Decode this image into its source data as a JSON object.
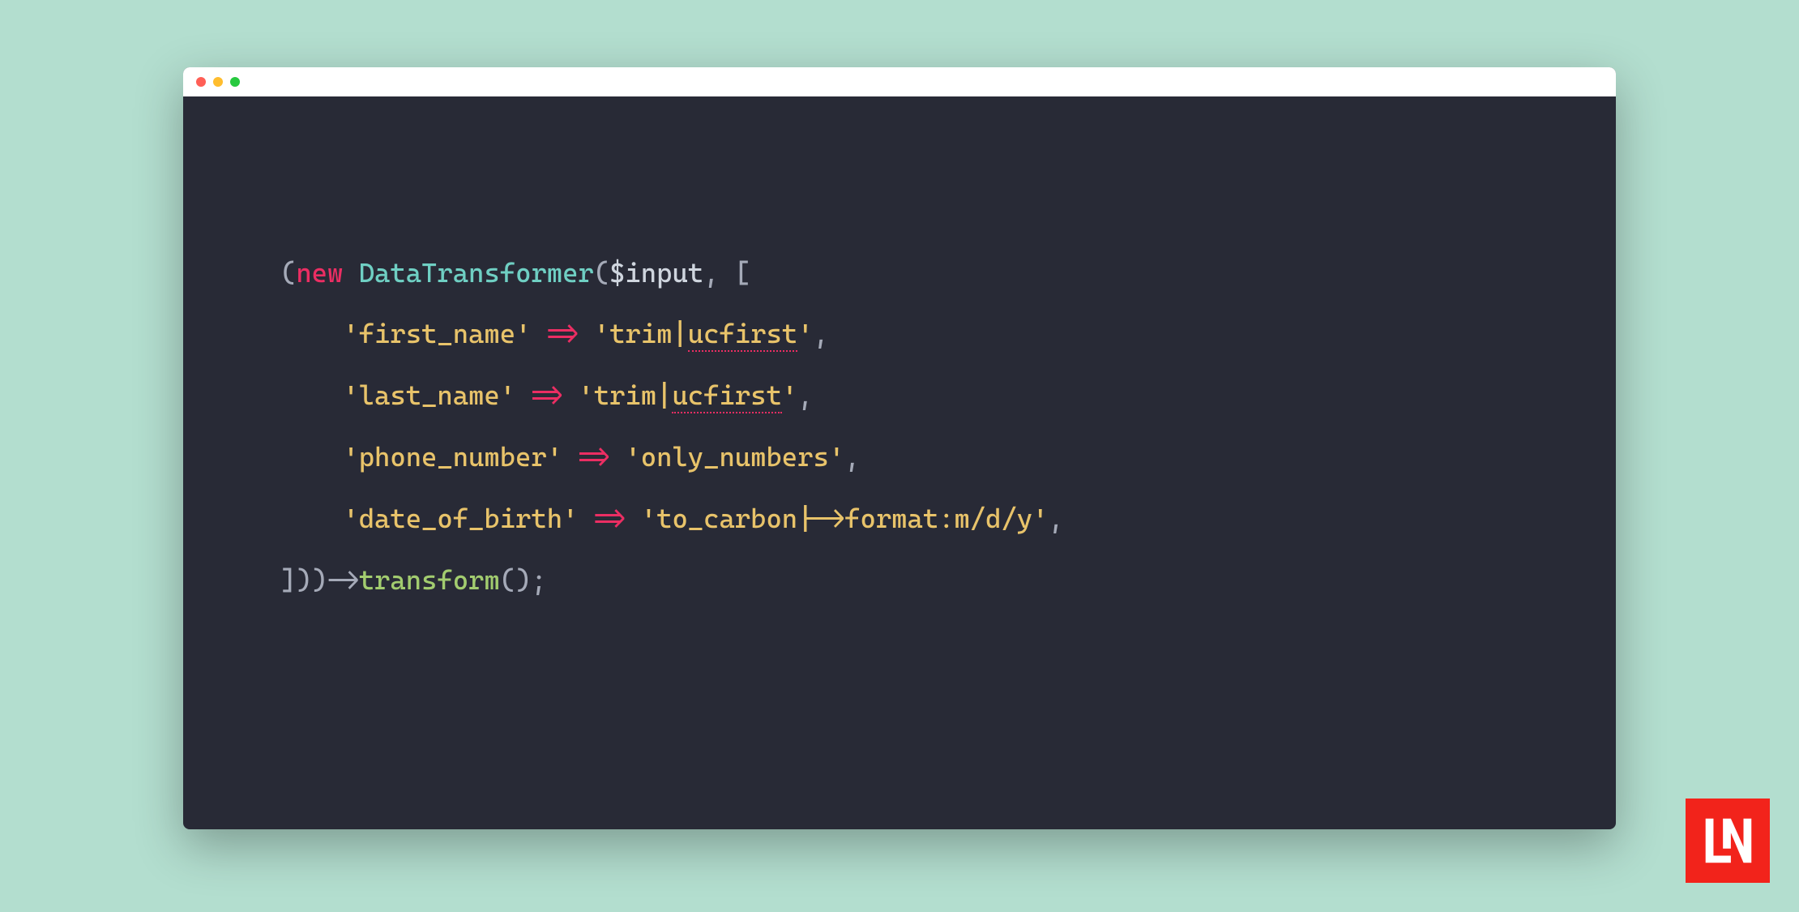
{
  "code": {
    "line1": {
      "paren_open": "(",
      "new_kw": "new",
      "space1": " ",
      "class_name": "DataTransformer",
      "paren2": "(",
      "variable": "$input",
      "comma": ", ",
      "bracket": "["
    },
    "entries": [
      {
        "indent": "    ",
        "q1": "'",
        "key": "first_name",
        "q2": "'",
        "arrow_space": " ",
        "arrow": "=>",
        "arrow_space2": " ",
        "q3": "'",
        "val_pre": "trim|",
        "val_err": "ucfirst",
        "val_post": "",
        "q4": "'",
        "comma": ","
      },
      {
        "indent": "    ",
        "q1": "'",
        "key": "last_name",
        "q2": "'",
        "arrow_space": " ",
        "arrow": "=>",
        "arrow_space2": " ",
        "q3": "'",
        "val_pre": "trim|",
        "val_err": "ucfirst",
        "val_post": "",
        "q4": "'",
        "comma": ","
      },
      {
        "indent": "    ",
        "q1": "'",
        "key": "phone_number",
        "q2": "'",
        "arrow_space": " ",
        "arrow": "=>",
        "arrow_space2": " ",
        "q3": "'",
        "val_pre": "only_numbers",
        "val_err": "",
        "val_post": "",
        "q4": "'",
        "comma": ","
      },
      {
        "indent": "    ",
        "q1": "'",
        "key": "date_of_birth",
        "q2": "'",
        "arrow_space": " ",
        "arrow": "=>",
        "arrow_space2": " ",
        "q3": "'",
        "val_pre": "to_carbon|->format:m/d/y",
        "val_err": "",
        "val_post": "",
        "q4": "'",
        "comma": ","
      }
    ],
    "last": {
      "close1": "]))",
      "arrow": "->",
      "method": "transform",
      "parens": "();"
    }
  },
  "colors": {
    "page_bg": "#b3decf",
    "editor_bg": "#282a36",
    "logo_bg": "#f2231b"
  }
}
